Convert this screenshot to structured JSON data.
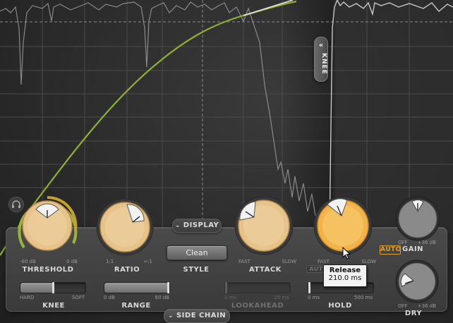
{
  "colors": {
    "accent_curve": "#8fb031",
    "knob_face": "#e8c58c",
    "knob_active": "#f2b44a",
    "auto_gain": "#e0a030"
  },
  "graph": {
    "knee_tab_label": "KNEE"
  },
  "display_toggle": {
    "label": "DISPLAY",
    "icon": "double-chevron-down-icon"
  },
  "side_chain_toggle": {
    "label": "SIDE CHAIN",
    "icon": "double-chevron-down-icon"
  },
  "knobs": {
    "threshold": {
      "label": "THRESHOLD",
      "min_label": "-60 dB",
      "max_label": "0 dB"
    },
    "ratio": {
      "label": "RATIO",
      "min_label": "1:1",
      "max_label": "∞:1"
    },
    "attack": {
      "label": "ATTACK",
      "min_label": "FAST",
      "max_label": "SLOW"
    },
    "release": {
      "label": "",
      "min_label": "FAST",
      "max_label": "SLOW"
    },
    "gain": {
      "label": "GAIN",
      "auto_label": "AUTO",
      "min_label": "OFF",
      "max_label": "+36 dB"
    },
    "dry": {
      "label": "DRY",
      "min_label": "OFF",
      "max_label": "+36 dB"
    }
  },
  "style": {
    "label": "STYLE",
    "value": "Clean"
  },
  "sliders": {
    "knee": {
      "label": "KNEE",
      "min_label": "HARD",
      "max_label": "SOFT",
      "value": 0.5
    },
    "range": {
      "label": "RANGE",
      "min_label": "0 dB",
      "max_label": "60 dB",
      "value": 1.0
    },
    "lookahead": {
      "label": "LOOKAHEAD",
      "min_label": "0 ms",
      "max_label": "20 ms",
      "value": 0.0
    },
    "hold": {
      "label": "HOLD",
      "min_label": "0 ms",
      "max_label": "500 ms",
      "value": 0.0
    }
  },
  "tooltip": {
    "title": "Release",
    "value": "210.0 ms"
  },
  "hidden_label_fragment": "AUT"
}
